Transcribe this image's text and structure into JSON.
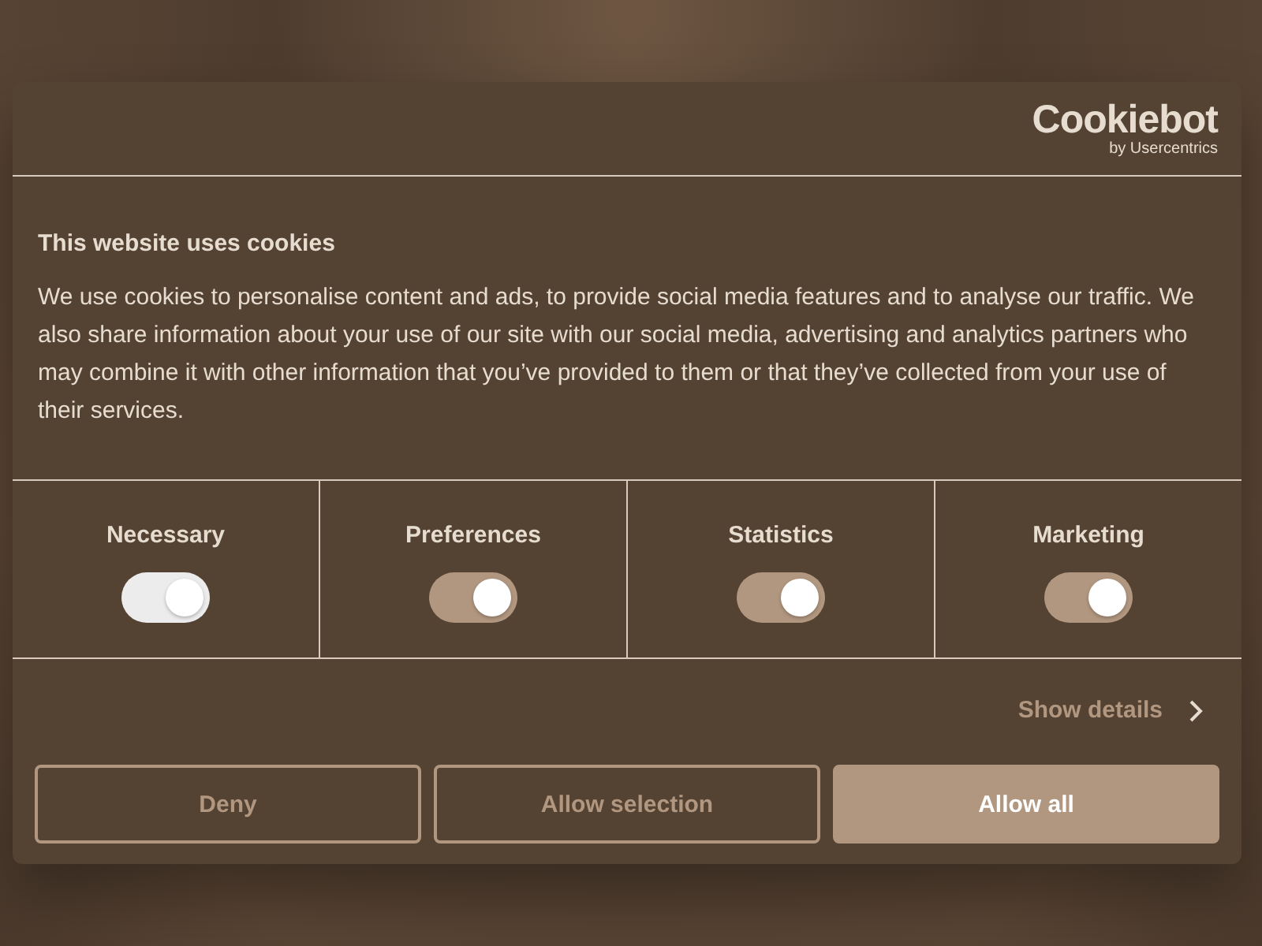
{
  "logo": {
    "name": "Cookiebot",
    "byline": "by Usercentrics"
  },
  "title": "This website uses cookies",
  "description": "We use cookies to personalise content and ads, to provide social media features and to analyse our traffic. We also share information about your use of our site with our social media, advertising and analytics partners who may combine it with other information that you’ve provided to them or that they’ve collected from your use of their services.",
  "categories": [
    {
      "label": "Necessary",
      "on": true,
      "disabled": true
    },
    {
      "label": "Preferences",
      "on": true,
      "disabled": false
    },
    {
      "label": "Statistics",
      "on": true,
      "disabled": false
    },
    {
      "label": "Marketing",
      "on": true,
      "disabled": false
    }
  ],
  "details_link": "Show details",
  "buttons": [
    {
      "label": "Deny",
      "kind": "outline"
    },
    {
      "label": "Allow selection",
      "kind": "outline"
    },
    {
      "label": "Allow all",
      "kind": "primary"
    }
  ]
}
